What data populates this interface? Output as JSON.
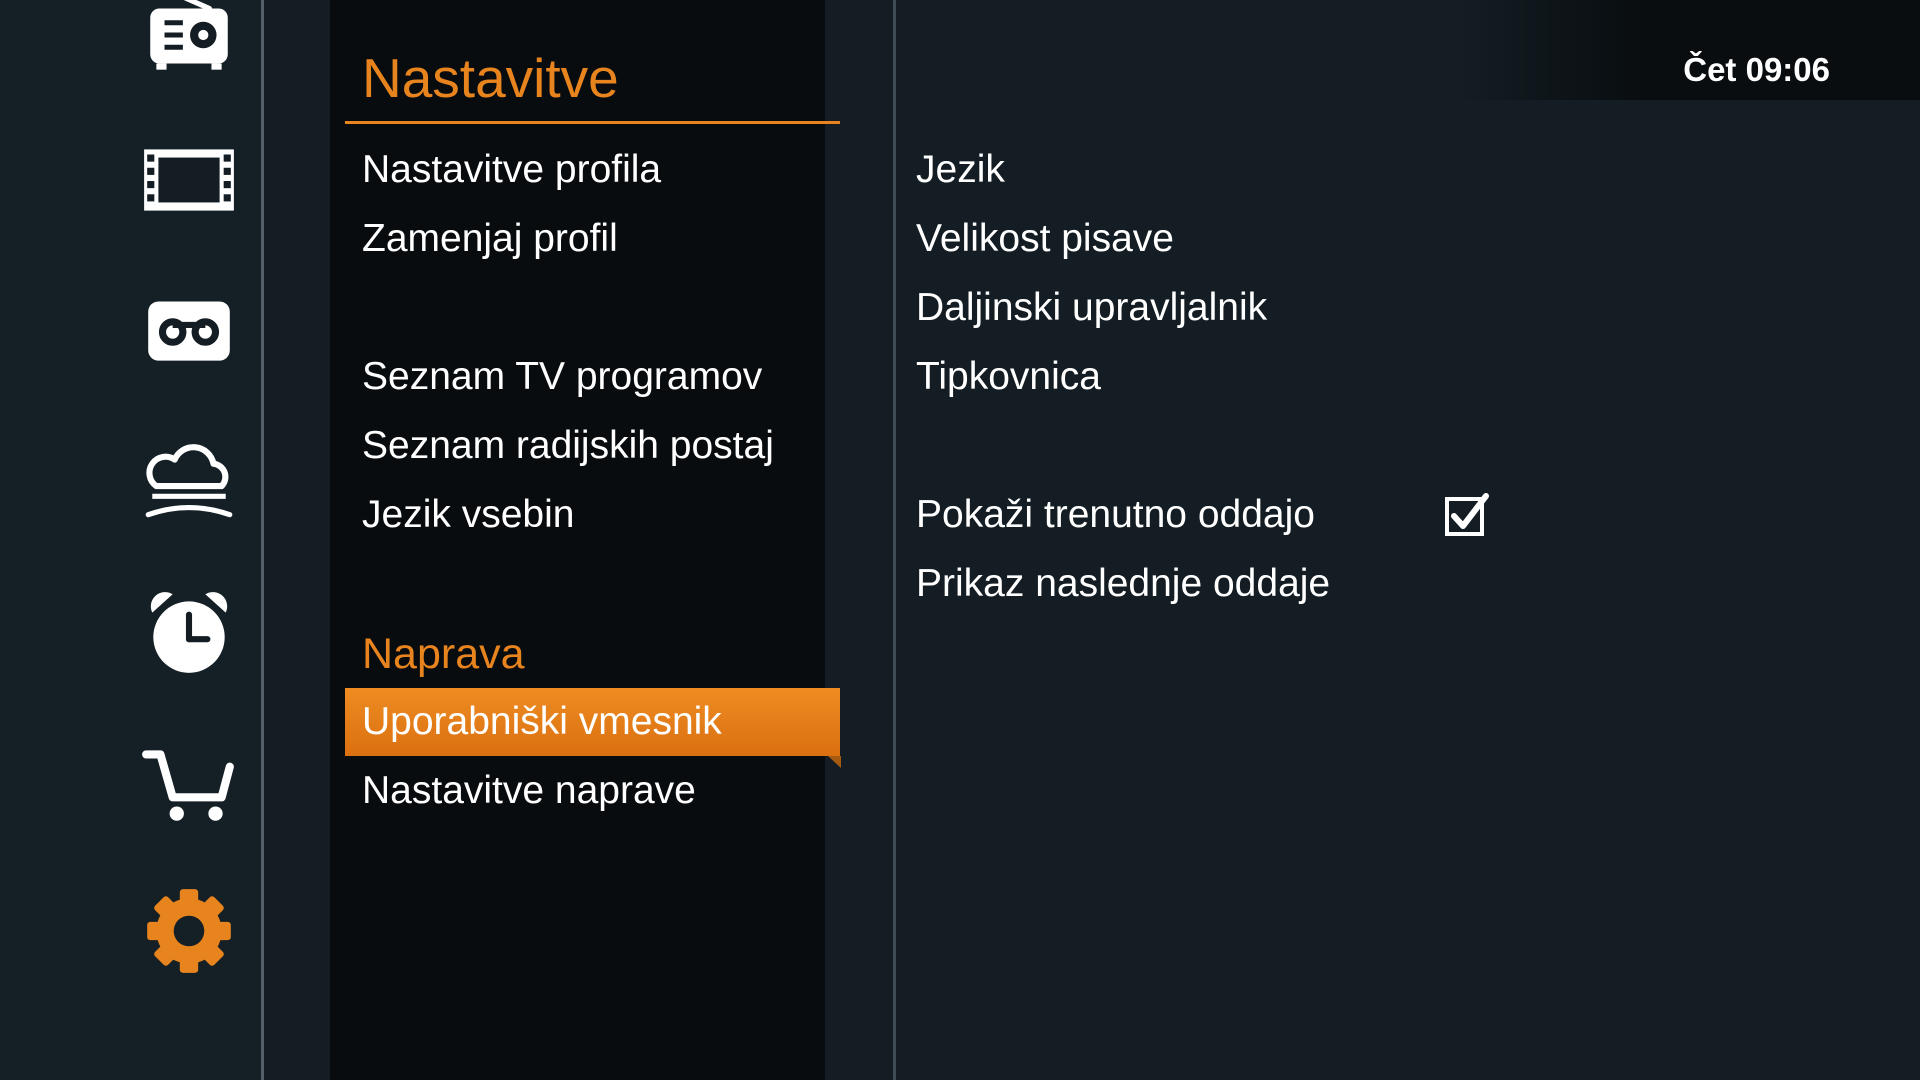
{
  "colors": {
    "accent": "#e8841e",
    "background": "#131d23",
    "panel": "#080c0f"
  },
  "sidebar": {
    "icons": [
      "radio-icon",
      "film-icon",
      "recording-icon",
      "cloud-icon",
      "alarm-clock-icon",
      "cart-icon",
      "gear-icon"
    ],
    "active_icon": "gear-icon"
  },
  "menu": {
    "title": "Nastavitve",
    "items": [
      {
        "label": "Nastavitve profila"
      },
      {
        "label": "Zamenjaj profil"
      },
      {
        "label": "Seznam TV programov"
      },
      {
        "label": "Seznam radijskih postaj"
      },
      {
        "label": "Jezik vsebin"
      }
    ],
    "section_heading": "Naprava",
    "device_items": [
      {
        "label": "Uporabniški vmesnik",
        "selected": true
      },
      {
        "label": "Nastavitve naprave",
        "selected": false
      }
    ]
  },
  "header": {
    "clock": "Čet 09:06"
  },
  "options": {
    "items": [
      {
        "label": "Jezik"
      },
      {
        "label": "Velikost pisave"
      },
      {
        "label": "Daljinski upravljalnik"
      },
      {
        "label": "Tipkovnica"
      }
    ],
    "toggles": [
      {
        "label": "Pokaži trenutno oddajo",
        "checked": true
      },
      {
        "label": "Prikaz naslednje oddaje"
      }
    ]
  }
}
